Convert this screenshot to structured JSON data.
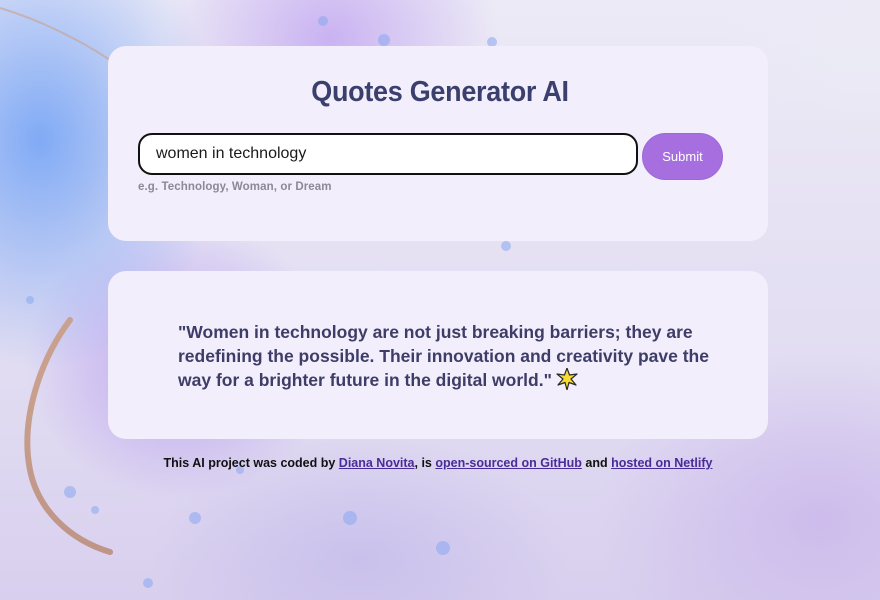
{
  "app": {
    "title": "Quotes Generator AI"
  },
  "search": {
    "value": "women in technology",
    "placeholder": "",
    "hint": "e.g. Technology, Woman, or Dream",
    "submit_label": "Submit"
  },
  "quote": {
    "text": "\"Women in technology are not just breaking barriers; they are redefining the possible. Their innovation and creativity pave the way for a brighter future in the digital world.\"",
    "emoji_icon": "sparkle-star-icon"
  },
  "footer": {
    "prefix": "This AI project was coded by ",
    "author_link": "Diana Novita",
    "middle1": ", is ",
    "github_link": "open-sourced on GitHub",
    "middle2": " and ",
    "netlify_link": "hosted on Netlify"
  },
  "colors": {
    "title": "#3a3f6e",
    "submit": "#a76ee0",
    "card": "#f3eefc",
    "link": "#4a2b9a"
  }
}
